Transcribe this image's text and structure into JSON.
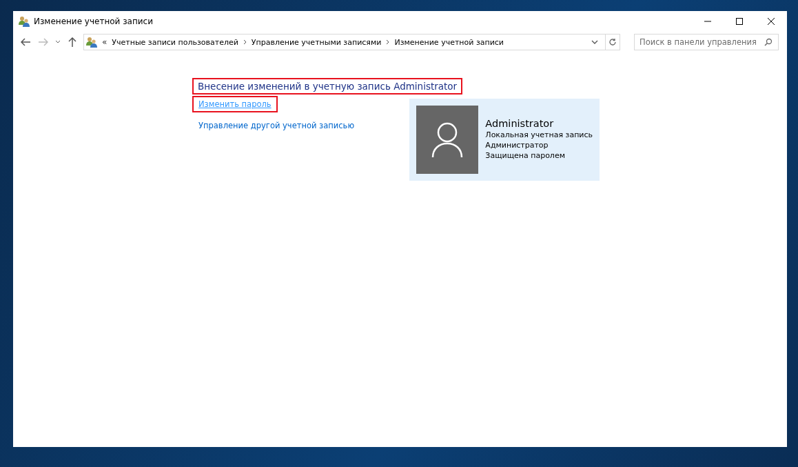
{
  "window": {
    "title": "Изменение учетной записи"
  },
  "breadcrumb": {
    "overflow": "«",
    "items": [
      "Учетные записи пользователей",
      "Управление учетными записями",
      "Изменение учетной записи"
    ]
  },
  "search": {
    "placeholder": "Поиск в панели управления"
  },
  "heading": {
    "text": "Внесение изменений в учетную запись Administrator",
    "highlighted": true
  },
  "links": [
    {
      "text": "Изменить пароль",
      "highlighted": true,
      "hovered": true
    },
    {
      "text": "Управление другой учетной записью",
      "highlighted": false,
      "hovered": false
    }
  ],
  "account": {
    "name": "Administrator",
    "details": [
      "Локальная учетная запись",
      "Администратор",
      "Защищена паролем"
    ]
  }
}
